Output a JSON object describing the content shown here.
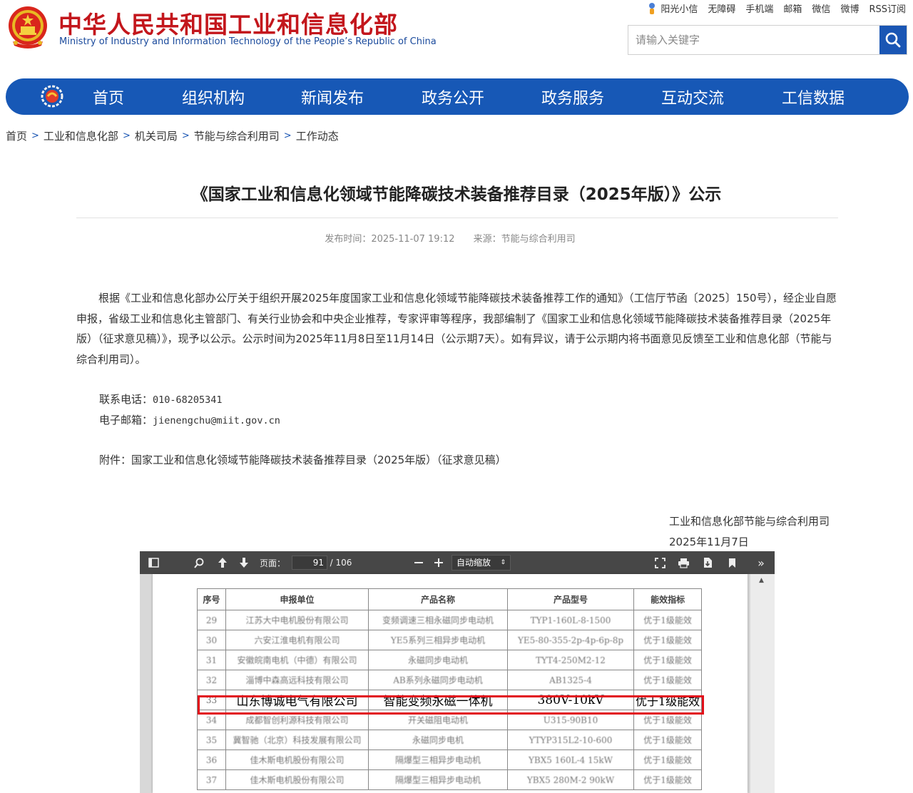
{
  "header": {
    "title": "中华人民共和国工业和信息化部",
    "subtitle": "Ministry of Industry and Information Technology of the People’s Republic of China",
    "toplinks": [
      "阳光小信",
      "无障碍",
      "手机端",
      "邮箱",
      "微信",
      "微博",
      "RSS订阅"
    ],
    "search_placeholder": "请输入关键字",
    "brand_red": "#c3161c",
    "brand_blue": "#1758b6"
  },
  "nav": {
    "items": [
      "首页",
      "组织机构",
      "新闻发布",
      "政务公开",
      "政务服务",
      "互动交流",
      "工信数据"
    ]
  },
  "breadcrumb": [
    "首页",
    "工业和信息化部",
    "机关司局",
    "节能与综合利用司",
    "工作动态"
  ],
  "article": {
    "title": "《国家工业和信息化领域节能降碳技术装备推荐目录（2025年版）》公示",
    "publish_time": "发布时间：2025-11-07 19:12",
    "source": "来源：节能与综合利用司",
    "paragraph": "根据《工业和信息化部办公厅关于组织开展2025年度国家工业和信息化领域节能降碳技术装备推荐工作的通知》（工信厅节函〔2025〕150号），经企业自愿申报，省级工业和信息化主管部门、有关行业协会和中央企业推荐，专家评审等程序，我部编制了《国家工业和信息化领域节能降碳技术装备推荐目录（2025年版）（征求意见稿）》，现予以公示。公示时间为2025年11月8日至11月14日（公示期7天）。如有异议，请于公示期内将书面意见反馈至工业和信息化部（节能与综合利用司）。",
    "phone_label": "联系电话：",
    "phone": "010-68205341",
    "email_label": "电子邮箱：",
    "email": "jienengchu@miit.gov.cn",
    "attachment": "附件：国家工业和信息化领域节能降碳技术装备推荐目录（2025年版）（征求意见稿）",
    "signature_org": "工业和信息化部节能与综合利用司",
    "signature_date": "2025年11月7日"
  },
  "pdf_viewer": {
    "page_label": "页面：",
    "current_page": "91",
    "total_pages": "/ 106",
    "zoom": "自动缩放",
    "table": {
      "headers": [
        "序号",
        "申报单位",
        "产品名称",
        "产品型号",
        "能效指标"
      ],
      "rows": [
        [
          "29",
          "江苏大中电机股份有限公司",
          "变频调速三相永磁同步电动机",
          "TYP1-160L-8-1500",
          "优于1级能效"
        ],
        [
          "30",
          "六安江淮电机有限公司",
          "YE5系列三相异步电动机",
          "YE5-80-355-2p-4p-6p-8p",
          "优于1级能效"
        ],
        [
          "31",
          "安徽皖南电机（中德）有限公司",
          "永磁同步电动机",
          "TYT4-250M2-12",
          "优于1级能效"
        ],
        [
          "32",
          "淄博中森高远科技有限公司",
          "AB系列永磁同步电动机",
          "AB1325-4",
          "优于1级能效"
        ],
        [
          "33",
          "山东博诚电气有限公司",
          "智能变频永磁一体机",
          "380V-10kV",
          "优于1级能效"
        ],
        [
          "34",
          "成都智创利源科技有限公司",
          "开关磁阻电动机",
          "U315-90B10",
          "优于1级能效"
        ],
        [
          "35",
          "冀智驰（北京）科技发展有限公司",
          "永磁同步电机",
          "YTYP315L2-10-600",
          "优于1级能效"
        ],
        [
          "36",
          "佳木斯电机股份有限公司",
          "隔爆型三相异步电动机",
          "YBX5 160L-4 15kW",
          "优于1级能效"
        ],
        [
          "37",
          "佳木斯电机股份有限公司",
          "隔爆型三相异步电动机",
          "YBX5 280M-2 90kW",
          "优于1级能效"
        ]
      ],
      "highlight_row": "33",
      "highlight_color": "#e2101a"
    }
  }
}
